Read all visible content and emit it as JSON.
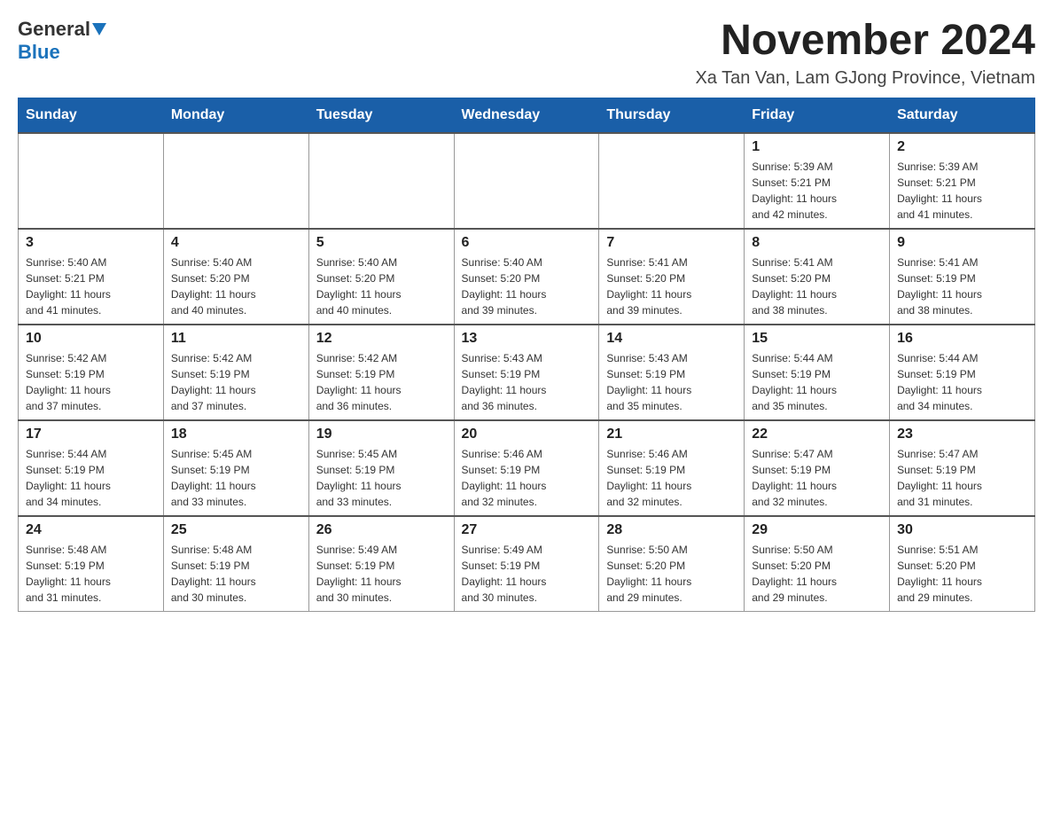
{
  "header": {
    "logo_general": "General",
    "logo_blue": "Blue",
    "month_title": "November 2024",
    "location": "Xa Tan Van, Lam GJong Province, Vietnam"
  },
  "weekdays": [
    "Sunday",
    "Monday",
    "Tuesday",
    "Wednesday",
    "Thursday",
    "Friday",
    "Saturday"
  ],
  "weeks": [
    [
      {
        "day": "",
        "info": ""
      },
      {
        "day": "",
        "info": ""
      },
      {
        "day": "",
        "info": ""
      },
      {
        "day": "",
        "info": ""
      },
      {
        "day": "",
        "info": ""
      },
      {
        "day": "1",
        "info": "Sunrise: 5:39 AM\nSunset: 5:21 PM\nDaylight: 11 hours\nand 42 minutes."
      },
      {
        "day": "2",
        "info": "Sunrise: 5:39 AM\nSunset: 5:21 PM\nDaylight: 11 hours\nand 41 minutes."
      }
    ],
    [
      {
        "day": "3",
        "info": "Sunrise: 5:40 AM\nSunset: 5:21 PM\nDaylight: 11 hours\nand 41 minutes."
      },
      {
        "day": "4",
        "info": "Sunrise: 5:40 AM\nSunset: 5:20 PM\nDaylight: 11 hours\nand 40 minutes."
      },
      {
        "day": "5",
        "info": "Sunrise: 5:40 AM\nSunset: 5:20 PM\nDaylight: 11 hours\nand 40 minutes."
      },
      {
        "day": "6",
        "info": "Sunrise: 5:40 AM\nSunset: 5:20 PM\nDaylight: 11 hours\nand 39 minutes."
      },
      {
        "day": "7",
        "info": "Sunrise: 5:41 AM\nSunset: 5:20 PM\nDaylight: 11 hours\nand 39 minutes."
      },
      {
        "day": "8",
        "info": "Sunrise: 5:41 AM\nSunset: 5:20 PM\nDaylight: 11 hours\nand 38 minutes."
      },
      {
        "day": "9",
        "info": "Sunrise: 5:41 AM\nSunset: 5:19 PM\nDaylight: 11 hours\nand 38 minutes."
      }
    ],
    [
      {
        "day": "10",
        "info": "Sunrise: 5:42 AM\nSunset: 5:19 PM\nDaylight: 11 hours\nand 37 minutes."
      },
      {
        "day": "11",
        "info": "Sunrise: 5:42 AM\nSunset: 5:19 PM\nDaylight: 11 hours\nand 37 minutes."
      },
      {
        "day": "12",
        "info": "Sunrise: 5:42 AM\nSunset: 5:19 PM\nDaylight: 11 hours\nand 36 minutes."
      },
      {
        "day": "13",
        "info": "Sunrise: 5:43 AM\nSunset: 5:19 PM\nDaylight: 11 hours\nand 36 minutes."
      },
      {
        "day": "14",
        "info": "Sunrise: 5:43 AM\nSunset: 5:19 PM\nDaylight: 11 hours\nand 35 minutes."
      },
      {
        "day": "15",
        "info": "Sunrise: 5:44 AM\nSunset: 5:19 PM\nDaylight: 11 hours\nand 35 minutes."
      },
      {
        "day": "16",
        "info": "Sunrise: 5:44 AM\nSunset: 5:19 PM\nDaylight: 11 hours\nand 34 minutes."
      }
    ],
    [
      {
        "day": "17",
        "info": "Sunrise: 5:44 AM\nSunset: 5:19 PM\nDaylight: 11 hours\nand 34 minutes."
      },
      {
        "day": "18",
        "info": "Sunrise: 5:45 AM\nSunset: 5:19 PM\nDaylight: 11 hours\nand 33 minutes."
      },
      {
        "day": "19",
        "info": "Sunrise: 5:45 AM\nSunset: 5:19 PM\nDaylight: 11 hours\nand 33 minutes."
      },
      {
        "day": "20",
        "info": "Sunrise: 5:46 AM\nSunset: 5:19 PM\nDaylight: 11 hours\nand 32 minutes."
      },
      {
        "day": "21",
        "info": "Sunrise: 5:46 AM\nSunset: 5:19 PM\nDaylight: 11 hours\nand 32 minutes."
      },
      {
        "day": "22",
        "info": "Sunrise: 5:47 AM\nSunset: 5:19 PM\nDaylight: 11 hours\nand 32 minutes."
      },
      {
        "day": "23",
        "info": "Sunrise: 5:47 AM\nSunset: 5:19 PM\nDaylight: 11 hours\nand 31 minutes."
      }
    ],
    [
      {
        "day": "24",
        "info": "Sunrise: 5:48 AM\nSunset: 5:19 PM\nDaylight: 11 hours\nand 31 minutes."
      },
      {
        "day": "25",
        "info": "Sunrise: 5:48 AM\nSunset: 5:19 PM\nDaylight: 11 hours\nand 30 minutes."
      },
      {
        "day": "26",
        "info": "Sunrise: 5:49 AM\nSunset: 5:19 PM\nDaylight: 11 hours\nand 30 minutes."
      },
      {
        "day": "27",
        "info": "Sunrise: 5:49 AM\nSunset: 5:19 PM\nDaylight: 11 hours\nand 30 minutes."
      },
      {
        "day": "28",
        "info": "Sunrise: 5:50 AM\nSunset: 5:20 PM\nDaylight: 11 hours\nand 29 minutes."
      },
      {
        "day": "29",
        "info": "Sunrise: 5:50 AM\nSunset: 5:20 PM\nDaylight: 11 hours\nand 29 minutes."
      },
      {
        "day": "30",
        "info": "Sunrise: 5:51 AM\nSunset: 5:20 PM\nDaylight: 11 hours\nand 29 minutes."
      }
    ]
  ]
}
